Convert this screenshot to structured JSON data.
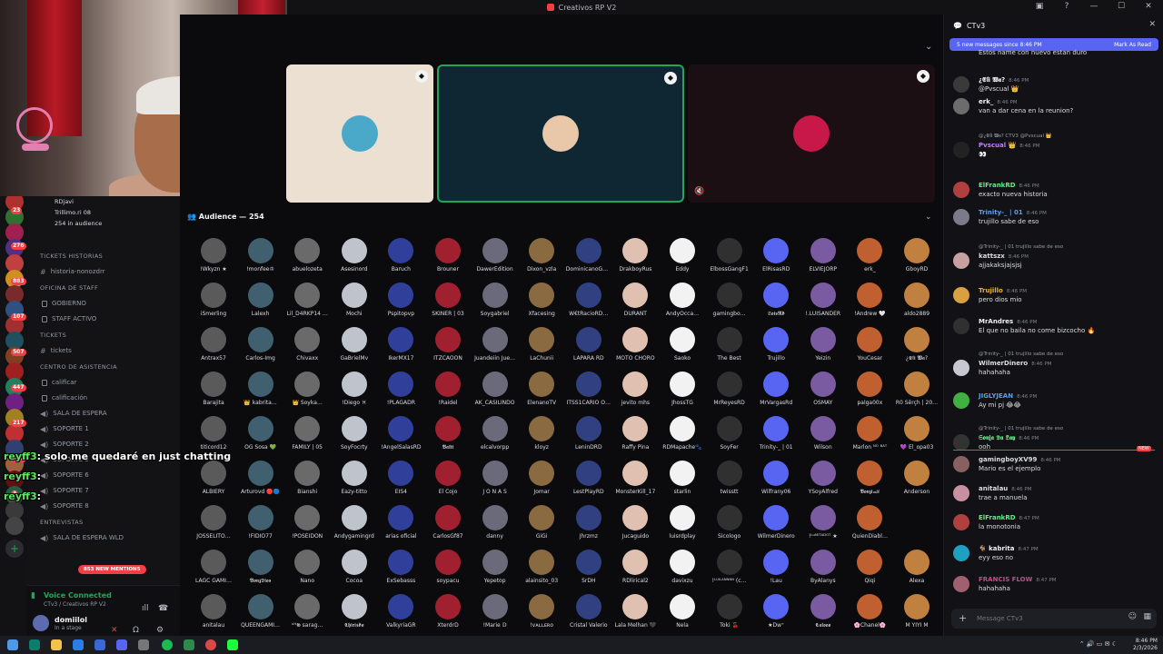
{
  "window": {
    "title": "Creativos RP V2"
  },
  "sidebar": {
    "server_badges": [
      "23",
      "276",
      "883",
      "107",
      "507",
      "447",
      "217",
      "427",
      "3"
    ],
    "speakers": [
      "RDjavi",
      "Trillimo.ri 08",
      "254 in audience"
    ],
    "channels": [
      {
        "type": "cat",
        "label": "TICKETS HISTORIAS"
      },
      {
        "type": "hash",
        "label": "historia-nonozdrr"
      },
      {
        "type": "cat",
        "label": "OFICINA DE STAFF"
      },
      {
        "type": "lock",
        "label": "GOBIERNO"
      },
      {
        "type": "lock",
        "label": "STAFF ACTIVO"
      },
      {
        "type": "cat",
        "label": "TICKETS"
      },
      {
        "type": "hash",
        "label": "tickets"
      },
      {
        "type": "cat",
        "label": "CENTRO DE ASISTENCIA"
      },
      {
        "type": "lock",
        "label": "calificar"
      },
      {
        "type": "lock",
        "label": "calificación"
      },
      {
        "type": "spk",
        "label": "SALA DE ESPERA"
      },
      {
        "type": "spk",
        "label": "SOPORTE 1"
      },
      {
        "type": "spk",
        "label": "SOPORTE 2"
      },
      {
        "type": "spk",
        "label": "SOPORTE 5"
      },
      {
        "type": "spk",
        "label": "SOPORTE 6"
      },
      {
        "type": "spk",
        "label": "SOPORTE 7"
      },
      {
        "type": "spk",
        "label": "SOPORTE 8"
      },
      {
        "type": "cat",
        "label": "ENTREVISTAS"
      },
      {
        "type": "spk",
        "label": "SALA DE ESPERA WLD"
      }
    ],
    "new_mentions": "853 NEW MENTIONS",
    "voice": {
      "title": "Voice Connected",
      "subtitle": "CTv3 / Creativos RP V2"
    },
    "user": {
      "name": "domiilol",
      "status": "In a stage"
    }
  },
  "overlay_chat": [
    {
      "who": "reyff3",
      "text": ": solo me quedaré en just chatting"
    },
    {
      "who": "reyff3",
      "text": ":"
    },
    {
      "who": "reyff3",
      "text": ":"
    }
  ],
  "stage": {
    "audience_header": "Audience — 254",
    "tiles": [
      {
        "color": "#4aa8c8"
      },
      {
        "color": "#e8c8a8"
      },
      {
        "color": "#c8184a"
      }
    ],
    "audience": [
      "!Wkyzn ★",
      "!monfee♔",
      "abuelozeta",
      "Asesinord",
      "Baruch",
      "Brouner",
      "DawerEdition",
      "Dixon_vzla",
      "DominicanoGa…",
      "DrakboyRus",
      "Eddy",
      "ElbossGangF1",
      "ElRisasRD",
      "ELVIEJORP",
      "erk_",
      "GboyRD",
      "iSmerling",
      "Lalexh",
      "Lil_D4RKP14 …",
      "Mochi",
      "Pspitopvp",
      "SKINER | 03",
      "Soygabriel",
      "Xfacesing",
      "W€tRacioRD…",
      "DURANT",
      "AndyOcca…",
      "gamingbo…",
      "𝕾𝖔𝖎𝖘𝕽𝖉",
      "!.LUISANDER",
      "!Andrew 🤍",
      "aldo2889",
      "Antrax57",
      "Carlos-Img",
      "Chivaxx",
      "GaBrielMv",
      "IkerMX17",
      "ITZCAOON",
      "Juandeiin Jue…",
      "LaChunii",
      "LAPARA RD",
      "MOTO CHORO",
      "Saoko",
      "The Best",
      "Trujillo",
      "Yeizin",
      "YouCesar",
      "¿𝕰𝖑𝖎 𝖂𝖆?",
      "Barajita",
      "👑 kabrita…",
      "👑 Soyka…",
      "!Diego ♓",
      "!PLAGADR",
      "!Raidel",
      "AK_CASILINDO",
      "ElenanoTV",
      "ITSS1CARIO O…",
      "jevito mhs",
      "JhossTG",
      "MrReyesRD",
      "MrVargasRd",
      "OSMAY",
      "palga00x",
      "R0 Šērçh | 20…",
      "titicord12",
      "OG Sosa 💚",
      "FAMILY | 05",
      "SoyFocrty",
      "!AngelSalasRD",
      "𝕭𝖆𝖑𝖙𝖎",
      "elcalvorpp",
      "kloyz",
      "LeninDRD",
      "Raffy Pina",
      "RDMapache🐾",
      "SoyFer",
      "Trinity-_ | 01",
      "Wilson",
      "Marlon ᴺᴼ ᴮᴬᵀ",
      "💜 El_opa03",
      "ALBIERY",
      "Arturovd 🔴🔵",
      "Bianshi",
      "Eazy-titto",
      "EIS4",
      "El Cojo",
      "J O N A S",
      "Jomar",
      "LestPlayRD",
      "MonsterKill_17",
      "starlin",
      "twisstt",
      "Wilfrany06",
      "YSoyAlfred",
      "𝕭𝖔𝖓𝖟𝖎🏎",
      "Anderson",
      "JOSSELITO…",
      "!FIDIO77",
      "!POSEIDON",
      "Andygamingrd",
      "arias oficial",
      "CarlosGf87",
      "danny",
      "GiGi",
      "Jhrzmz",
      "Jucaguido",
      "luisrdplay",
      "Sicologo",
      "WilmerDinero",
      "!ᴸᵘᴹᴵᵀᴬᴰᴼᵀ ★",
      "QuienDiabl…",
      "",
      "LAGC GAMI…",
      "𝕭𝖔𝖓𝖟𝕯𝖎𝖔𝖘",
      "Nano",
      "Cocoa",
      "ExSebasss",
      "soypacu",
      "Yepetop",
      "alainsito_03",
      "SrDH",
      "RDlirical2",
      "davixzu",
      "!ᴸᵁᴵᴸᴬᴺᴺᴺᴺ (c…",
      "!Lau",
      "ByAlanys",
      "Qiqi",
      "Alexa",
      "anitalau",
      "QUEENGAMI…",
      "ᵘᴴ𝕲 sarag…",
      "𝕮𝖍𝖎𝖗𝖎𝖘𝖉𝖆",
      "ValkyriaGR",
      "XterdrD",
      "!Marie 𝔻",
      "!ᴠᴀʟʟᴇʀᴏ",
      "Cristal Valerio",
      "Lala Melhan 🖤",
      "Nela",
      "Toki 🍒",
      "★Dw⁺",
      "𝕮𝖆𝖑𝖔𝖔𝖔",
      "🌸Chanel🌸",
      "M YIYI M"
    ]
  },
  "chat": {
    "channel": "CTv3",
    "new_bar": {
      "left": "5 new messages since 8:46 PM",
      "right": "Mark As Read"
    },
    "messages": [
      {
        "author": "",
        "time": "",
        "text": "Estos name con nuevo estan duro",
        "reply": "",
        "color": "#dbdee1",
        "av": "#2a2a2a"
      },
      {
        "author": "¿𝕰𝖑𝖎 𝖂𝖆?",
        "time": "8:46 PM",
        "text": "@Pvscual 👑",
        "reply": "",
        "color": "#f2f3f5",
        "av": "#3a3a3a"
      },
      {
        "author": "erk_",
        "time": "8:46 PM",
        "text": "van a dar cena en la reunion?",
        "reply": "",
        "color": "#f2f3f5",
        "av": "#6c6c6c"
      },
      {
        "author": "Pvscual 👑",
        "time": "8:46 PM",
        "text": "👀",
        "reply": "@¿𝕰𝖑𝖎 𝖂𝖆? CTV3 @Pvscual 👑",
        "color": "#c879ff",
        "av": "#222"
      },
      {
        "author": "ElFrankRD",
        "time": "8:46 PM",
        "text": "exacto nueva historia",
        "reply": "",
        "color": "#57f287",
        "av": "#b04040"
      },
      {
        "author": "Trinity-_ | 01",
        "time": "8:46 PM",
        "text": "trujillo sabe de eso",
        "reply": "",
        "color": "#5d9ef2",
        "av": "#7a7a88"
      },
      {
        "author": "kattszx",
        "time": "8:46 PM",
        "text": "ajjakaksjajsjsj",
        "reply": "@Trinity-_ | 01 trujillo sabe de eso",
        "color": "#dbdee1",
        "av": "#c8a0a0"
      },
      {
        "author": "Trujillo",
        "time": "8:46 PM",
        "text": "pero dios mio",
        "reply": "",
        "color": "#f0b232",
        "av": "#d8a040"
      },
      {
        "author": "MrAndres",
        "time": "8:46 PM",
        "text": "El que no baila no come bizcocho 🔥",
        "reply": "",
        "color": "#f2f3f5",
        "av": "#303030"
      },
      {
        "author": "WilmerDinero",
        "time": "8:46 PM",
        "text": "hahahaha",
        "reply": "@Trinity-_ | 01 trujillo sabe de eso",
        "color": "#dbdee1",
        "av": "#c8c8d0"
      },
      {
        "author": "JIGLYJEAN",
        "time": "8:46 PM",
        "text": "Ay mi pj 😂😂",
        "reply": "",
        "color": "#5d9ef2",
        "av": "#40b040"
      },
      {
        "author": "𝕾𝖔𝖓𝖏𝖆 𝕯𝖆 𝕷𝖆𝖞",
        "time": "8:46 PM",
        "text": "ooh",
        "reply": "@Trinity-_ | 01 trujillo sabe de eso",
        "color": "#57f287",
        "av": "#333"
      },
      {
        "author": "gamingboyXV99",
        "time": "8:46 PM",
        "text": "Mario es el ejemplo",
        "reply": "",
        "color": "#dbdee1",
        "av": "#886060"
      },
      {
        "author": "anitalau",
        "time": "8:46 PM",
        "text": "trae a manuela",
        "reply": "",
        "color": "#dbdee1",
        "av": "#c890a0"
      },
      {
        "author": "ElFrankRD",
        "time": "8:47 PM",
        "text": "la monotonia",
        "reply": "",
        "color": "#57f287",
        "av": "#b04040"
      },
      {
        "author": "🐐 kabrita",
        "time": "8:47 PM",
        "text": "eyy eso no",
        "reply": "",
        "color": "#f2f3f5",
        "av": "#20a0c0"
      },
      {
        "author": "FRANCIS FLOW",
        "time": "8:47 PM",
        "text": "hahahaha",
        "reply": "",
        "color": "#c84a8a",
        "av": "#a06070"
      }
    ],
    "new_tag": "NEW",
    "input_placeholder": "Message CTv3"
  },
  "taskbar": {
    "time": "8:46 PM",
    "date": "2/3/2026"
  }
}
